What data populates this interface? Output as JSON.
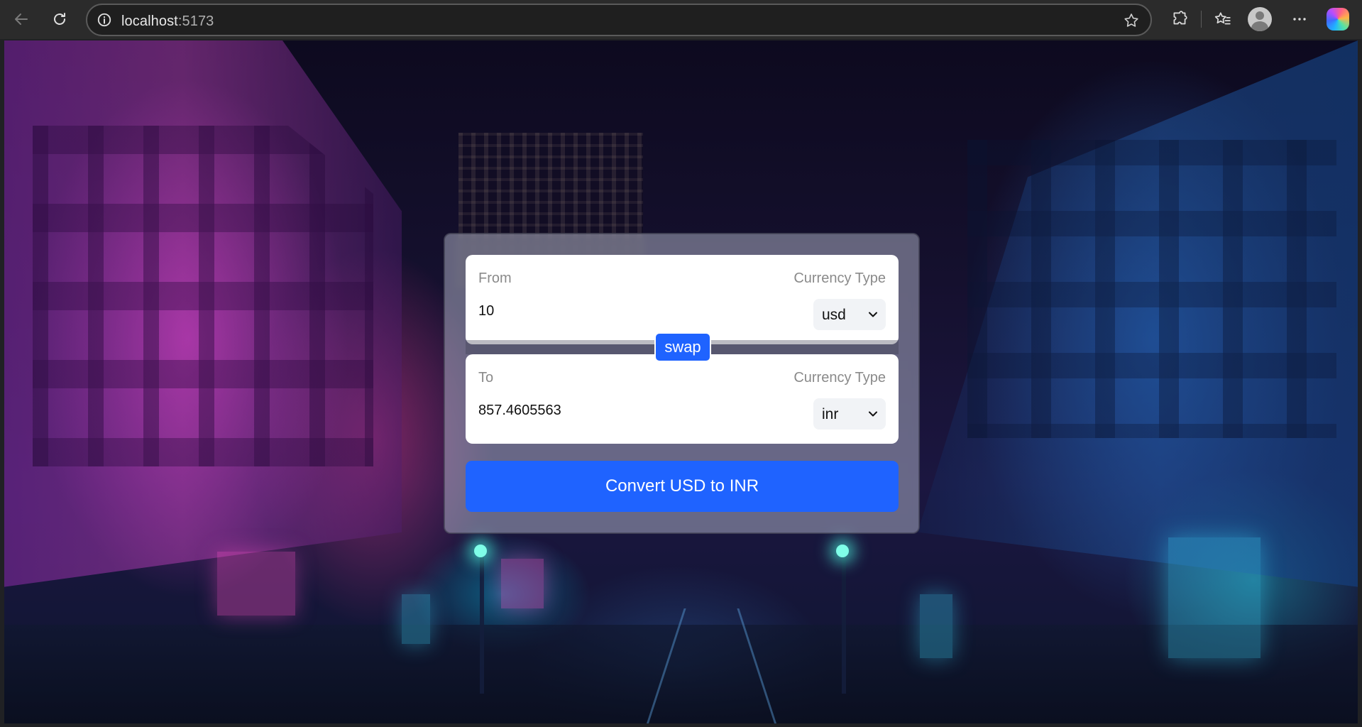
{
  "browser": {
    "url_host": "localhost",
    "url_port": ":5173"
  },
  "converter": {
    "from": {
      "label": "From",
      "currency_label": "Currency Type",
      "amount": "10",
      "currency": "usd"
    },
    "swap_label": "swap",
    "to": {
      "label": "To",
      "currency_label": "Currency Type",
      "amount": "857.4605563",
      "currency": "inr"
    },
    "convert_label": "Convert USD to INR"
  },
  "colors": {
    "accent": "#1f63ff",
    "panel": "#ffffff",
    "chrome": "#2b2b2b"
  },
  "icons": [
    "back-arrow-icon",
    "refresh-icon",
    "info-icon",
    "star-icon",
    "extensions-icon",
    "favorites-icon",
    "profile-avatar-icon",
    "more-icon",
    "copilot-icon",
    "chevron-down-icon"
  ]
}
